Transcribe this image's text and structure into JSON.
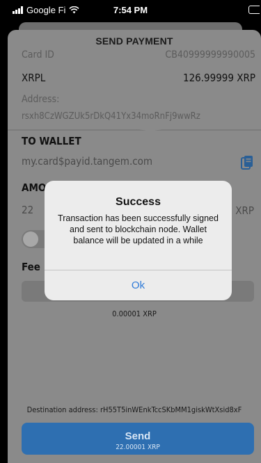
{
  "status_bar": {
    "carrier": "Google Fi",
    "time": "7:54 PM"
  },
  "sheet": {
    "title": "SEND PAYMENT",
    "card_id_label": "Card ID",
    "card_id_value": "CB40999999990005",
    "network": "XRPL",
    "balance": "126.99999 XRP",
    "address_label": "Address:",
    "address_value": "rsxh8CzWGZUk5rDkQ41Yx34moRnFj9wwRz",
    "to_wallet_label": "TO WALLET",
    "to_wallet_value": "my.card$payid.tangem.com",
    "amount_label": "AMO",
    "amount_value": "22",
    "amount_unit": "XRP",
    "fee_label": "Fee",
    "fee_value": "0.00001 XRP",
    "destination": "Destination address: rH55T5inWEnkTccSKbMM1giskWtXsid8xF",
    "send_label": "Send",
    "send_sub": "22.00001 XRP"
  },
  "alert": {
    "title": "Success",
    "message": "Transaction has been successfully signed and sent to blockchain node. Wallet balance will be updated in a while",
    "ok_label": "Ok"
  },
  "colors": {
    "overlay": "#8a8a8a",
    "accent": "#2e6fb1",
    "alert_link": "#2f7bd8"
  }
}
